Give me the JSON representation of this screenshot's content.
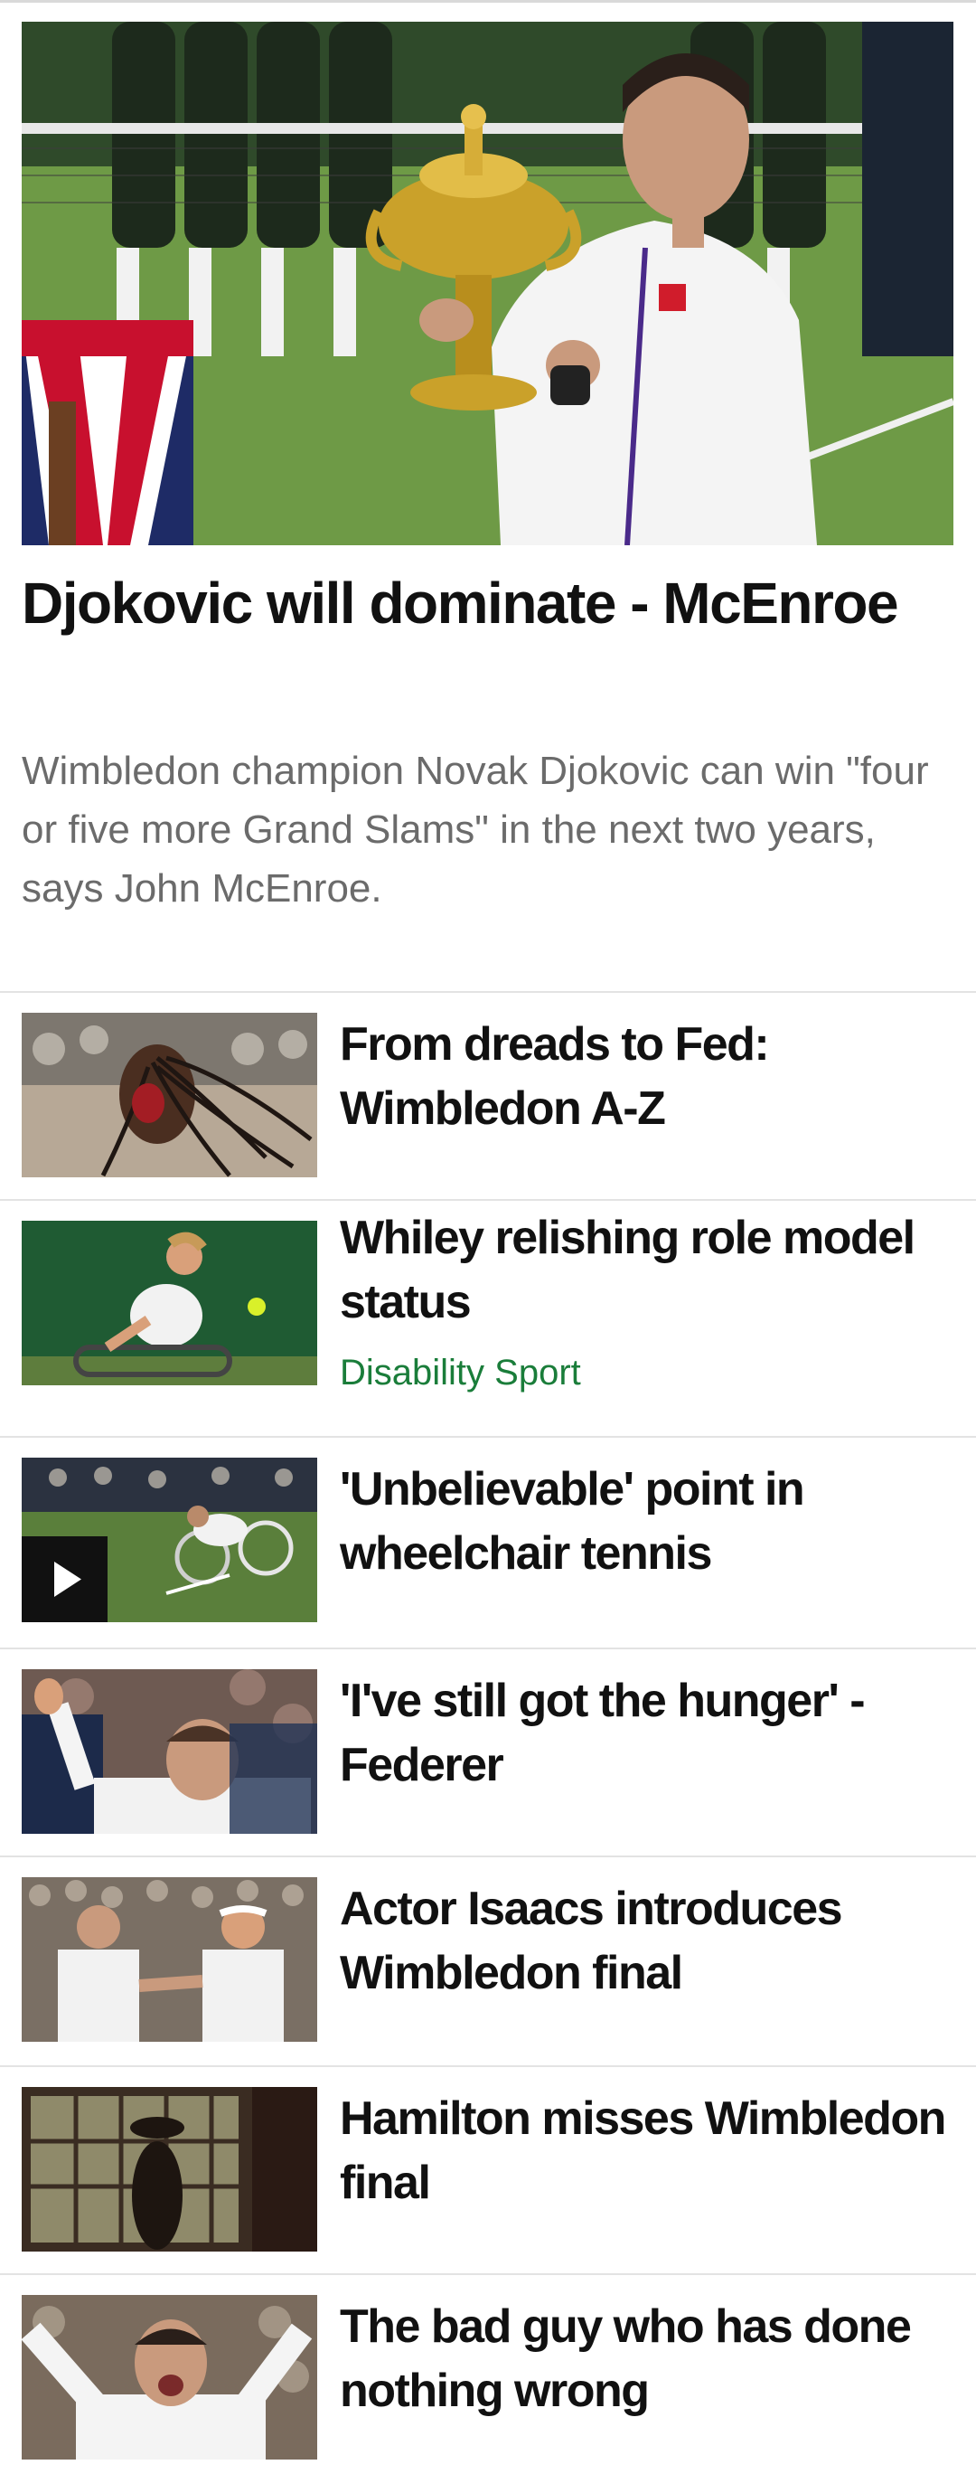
{
  "hero": {
    "image_icon": "wimbledon-trophy-photo",
    "title": "Djokovic will dominate - McEnroe",
    "summary": "Wimbledon champion Novak Djokovic can win \"four or five more Grand Slams\" in the next two years, says John McEnroe."
  },
  "stories": [
    {
      "title": "From dreads to Fed: Wimbledon A-Z",
      "tag": "",
      "has_video": false
    },
    {
      "title": "Whiley relishing role model status",
      "tag": "Disability Sport",
      "has_video": false
    },
    {
      "title": "'Unbelievable' point in wheelchair tennis",
      "tag": "",
      "has_video": true
    },
    {
      "title": "'I've still got the hunger' - Federer",
      "tag": "",
      "has_video": false
    },
    {
      "title": "Actor Isaacs introduces Wimbledon final",
      "tag": "",
      "has_video": false
    },
    {
      "title": "Hamilton misses Wimbledon final",
      "tag": "",
      "has_video": false
    },
    {
      "title": "The bad guy who has done nothing wrong",
      "tag": "",
      "has_video": false
    }
  ],
  "colors": {
    "tag_green": "#1a7d3a",
    "title_text": "#111111",
    "summary_text": "#6b6b6b",
    "divider": "#e3e3e3",
    "grass": "#5f8a3c"
  },
  "icons": {
    "play": "play-icon"
  }
}
